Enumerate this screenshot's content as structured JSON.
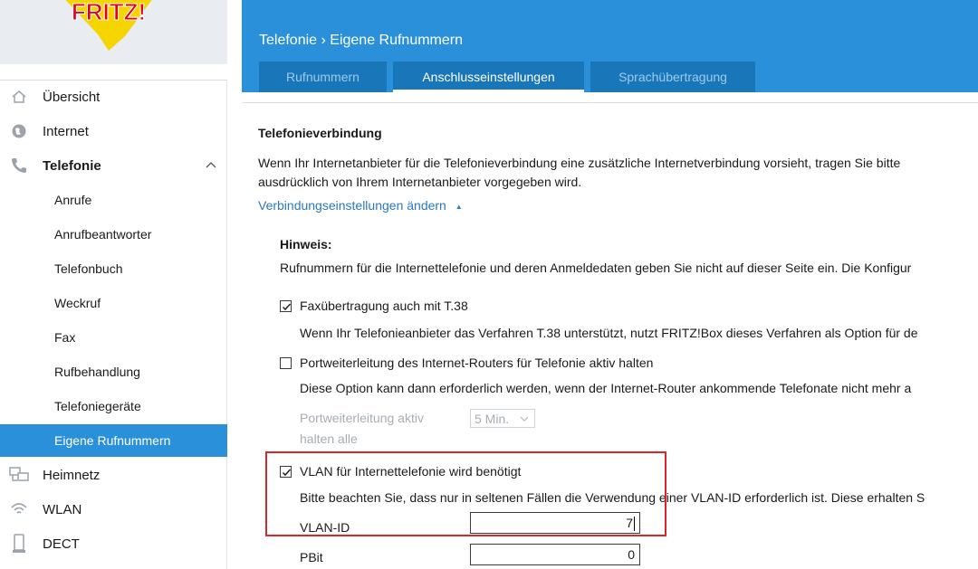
{
  "brand": {
    "logo_text": "FRITZ!"
  },
  "sidebar": {
    "items": [
      {
        "label": "Übersicht",
        "icon": "home-icon"
      },
      {
        "label": "Internet",
        "icon": "globe-icon"
      },
      {
        "label": "Telefonie",
        "icon": "phone-icon"
      },
      {
        "label": "Heimnetz",
        "icon": "network-icon"
      },
      {
        "label": "WLAN",
        "icon": "wifi-icon"
      },
      {
        "label": "DECT",
        "icon": "dect-phone-icon"
      }
    ],
    "subitems": [
      {
        "label": "Anrufe"
      },
      {
        "label": "Anrufbeantworter"
      },
      {
        "label": "Telefonbuch"
      },
      {
        "label": "Weckruf"
      },
      {
        "label": "Fax"
      },
      {
        "label": "Rufbehandlung"
      },
      {
        "label": "Telefoniegeräte"
      },
      {
        "label": "Eigene Rufnummern"
      }
    ]
  },
  "header": {
    "breadcrumb": "Telefonie › Eigene Rufnummern",
    "tabs": [
      {
        "label": "Rufnummern"
      },
      {
        "label": "Anschlusseinstellungen"
      },
      {
        "label": "Sprachübertragung"
      }
    ]
  },
  "main": {
    "section_title": "Telefonieverbindung",
    "intro_line1": "Wenn Ihr Internetanbieter für die Telefonieverbindung eine zusätzliche Internetverbindung vorsieht, tragen Sie bitte",
    "intro_line2": "ausdrücklich von Ihrem Internetanbieter vorgegeben wird.",
    "toggle_link": "Verbindungseinstellungen ändern",
    "toggle_arrow": "▲",
    "hint_title": "Hinweis:",
    "hint_text": "Rufnummern für die Internettelefonie und deren Anmeldedaten geben Sie nicht auf dieser Seite ein. Die Konfigur",
    "fax": {
      "label": "Faxübertragung auch mit T.38",
      "checked": true,
      "desc": "Wenn Ihr Telefonieanbieter das Verfahren T.38 unterstützt, nutzt FRITZ!Box dieses Verfahren als Option für de"
    },
    "port": {
      "label": "Portweiterleitung des Internet-Routers für Telefonie aktiv halten",
      "checked": false,
      "desc": "Diese Option kann dann erforderlich werden, wenn der Internet-Router ankommende Telefonate nicht mehr a",
      "keep_label_1": "Portweiterleitung aktiv",
      "keep_label_2": "halten alle",
      "interval": "5 Min."
    },
    "vlan": {
      "label": "VLAN für Internettelefonie wird benötigt",
      "checked": true,
      "desc": "Bitte beachten Sie, dass nur in seltenen Fällen die Verwendung einer VLAN-ID erforderlich ist. Diese erhalten S",
      "id_label": "VLAN-ID",
      "id_value": "7",
      "pbit_label": "PBit",
      "pbit_value": "0"
    }
  },
  "colors": {
    "accent": "#2a90d9",
    "tab_bg": "#1976b9",
    "highlight": "#d7272a"
  }
}
